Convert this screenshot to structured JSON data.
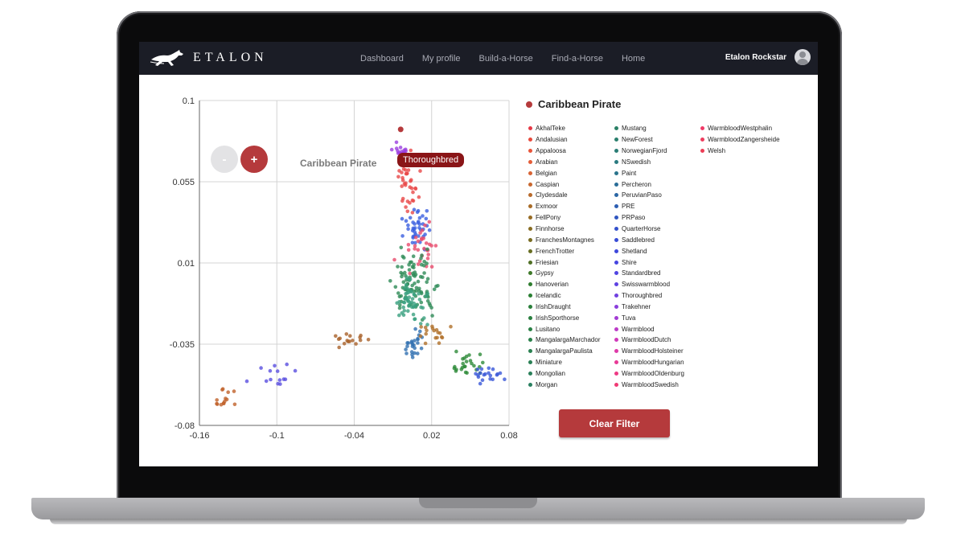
{
  "app": {
    "name": "ETALON"
  },
  "nav": {
    "links": [
      "Dashboard",
      "My profile",
      "Build-a-Horse",
      "Find-a-Horse",
      "Home"
    ],
    "user": "Etalon Rockstar"
  },
  "controls": {
    "zoom_out": "-",
    "zoom_in": "+",
    "clear_filter": "Clear Filter"
  },
  "selected": {
    "name": "Caribbean Pirate",
    "tooltip": "Thoroughbred",
    "color": "#b53a3c"
  },
  "chart_data": {
    "type": "scatter",
    "xlim": [
      -0.16,
      0.08
    ],
    "ylim": [
      -0.08,
      0.1
    ],
    "x_ticks": [
      "-0.16",
      "-0.1",
      "-0.04",
      "0.02",
      "0.08"
    ],
    "y_ticks": [
      "0.1",
      "0.055",
      "0.01",
      "-0.035",
      "-0.08"
    ],
    "grid": true,
    "highlight": {
      "label": "Caribbean Pirate",
      "breed": "Thoroughbred",
      "x": -0.004,
      "y": 0.084
    },
    "clusters": [
      {
        "breed_group": "Thoroughbred",
        "color": "#9b3fe0",
        "center": [
          -0.003,
          0.07
        ],
        "spread": [
          0.003,
          0.003
        ],
        "n": 26
      },
      {
        "breed_group": "Arabian",
        "color": "#e84848",
        "center": [
          0.002,
          0.055
        ],
        "spread": [
          0.004,
          0.008
        ],
        "n": 40
      },
      {
        "breed_group": "Saddlebred",
        "color": "#3b5fe0",
        "center": [
          0.008,
          0.03
        ],
        "spread": [
          0.005,
          0.005
        ],
        "n": 40
      },
      {
        "breed_group": "Warmblood",
        "color": "#e84a6b",
        "center": [
          0.012,
          0.018
        ],
        "spread": [
          0.008,
          0.006
        ],
        "n": 30
      },
      {
        "breed_group": "Hanoverian",
        "color": "#2e8b57",
        "center": [
          0.008,
          -0.002
        ],
        "spread": [
          0.008,
          0.008
        ],
        "n": 90
      },
      {
        "breed_group": "Morgan",
        "color": "#3aa080",
        "center": [
          0.004,
          -0.012
        ],
        "spread": [
          0.006,
          0.006
        ],
        "n": 50
      },
      {
        "breed_group": "Paint",
        "color": "#2f6fb0",
        "center": [
          0.005,
          -0.035
        ],
        "spread": [
          0.004,
          0.004
        ],
        "n": 25
      },
      {
        "breed_group": "FellPony",
        "color": "#b0702a",
        "center": [
          0.02,
          -0.03
        ],
        "spread": [
          0.006,
          0.003
        ],
        "n": 18
      },
      {
        "breed_group": "Icelandic",
        "color": "#2e8b3a",
        "center": [
          0.045,
          -0.047
        ],
        "spread": [
          0.008,
          0.004
        ],
        "n": 25
      },
      {
        "breed_group": "Shetland",
        "color": "#3a58d8",
        "center": [
          0.064,
          -0.053
        ],
        "spread": [
          0.005,
          0.003
        ],
        "n": 20
      },
      {
        "breed_group": "Exmoor",
        "color": "#a9622a",
        "center": [
          -0.042,
          -0.033
        ],
        "spread": [
          0.008,
          0.002
        ],
        "n": 16
      },
      {
        "breed_group": "Shire",
        "color": "#5a4fe0",
        "center": [
          -0.1,
          -0.052
        ],
        "spread": [
          0.01,
          0.003
        ],
        "n": 14
      },
      {
        "breed_group": "Caspian",
        "color": "#c0622a",
        "center": [
          -0.142,
          -0.064
        ],
        "spread": [
          0.006,
          0.003
        ],
        "n": 14
      }
    ]
  },
  "legend": {
    "columns": [
      [
        {
          "label": "AkhalTeke",
          "color": "#e63946"
        },
        {
          "label": "Andalusian",
          "color": "#e84a3c"
        },
        {
          "label": "Appaloosa",
          "color": "#e8553a"
        },
        {
          "label": "Arabian",
          "color": "#e45d38"
        },
        {
          "label": "Belgian",
          "color": "#d86435"
        },
        {
          "label": "Caspian",
          "color": "#c8672f"
        },
        {
          "label": "Clydesdale",
          "color": "#b86a2b"
        },
        {
          "label": "Exmoor",
          "color": "#a86b27"
        },
        {
          "label": "FellPony",
          "color": "#986c24"
        },
        {
          "label": "Finnhorse",
          "color": "#886c22"
        },
        {
          "label": "FranchesMontagnes",
          "color": "#786c21"
        },
        {
          "label": "FrenchTrotter",
          "color": "#686e22"
        },
        {
          "label": "Friesian",
          "color": "#507025"
        },
        {
          "label": "Gypsy",
          "color": "#3f7a2a"
        },
        {
          "label": "Hanoverian",
          "color": "#2f7d2f"
        },
        {
          "label": "Icelandic",
          "color": "#2a7f33"
        },
        {
          "label": "IrishDraught",
          "color": "#2a7f3a"
        },
        {
          "label": "IrishSporthorse",
          "color": "#2a7f40"
        },
        {
          "label": "Lusitano",
          "color": "#2a8045"
        },
        {
          "label": "MangalargaMarchador",
          "color": "#2a804a"
        },
        {
          "label": "MangalargaPaulista",
          "color": "#2a8050"
        },
        {
          "label": "Miniature",
          "color": "#2a8055"
        },
        {
          "label": "Mongolian",
          "color": "#2a805a"
        },
        {
          "label": "Morgan",
          "color": "#2a8060"
        }
      ],
      [
        {
          "label": "Mustang",
          "color": "#2a8066"
        },
        {
          "label": "NewForest",
          "color": "#2a7f6d"
        },
        {
          "label": "NorwegianFjord",
          "color": "#2a7d75"
        },
        {
          "label": "NSwedish",
          "color": "#2a7a80"
        },
        {
          "label": "Paint",
          "color": "#2a748c"
        },
        {
          "label": "Percheron",
          "color": "#2a6d98"
        },
        {
          "label": "PeruvianPaso",
          "color": "#2a66a4"
        },
        {
          "label": "PRE",
          "color": "#2c5eb2"
        },
        {
          "label": "PRPaso",
          "color": "#2f56c0"
        },
        {
          "label": "QuarterHorse",
          "color": "#3350cc"
        },
        {
          "label": "Saddlebred",
          "color": "#384cd6"
        },
        {
          "label": "Shetland",
          "color": "#3e48dc"
        },
        {
          "label": "Shire",
          "color": "#4645e0"
        },
        {
          "label": "Standardbred",
          "color": "#5044e2"
        },
        {
          "label": "Swisswarmblood",
          "color": "#5e42e2"
        },
        {
          "label": "Thoroughbred",
          "color": "#7040e0"
        },
        {
          "label": "Trakehner",
          "color": "#8a3edc"
        },
        {
          "label": "Tuva",
          "color": "#a33cd4"
        },
        {
          "label": "Warmblood",
          "color": "#bc3bc8"
        },
        {
          "label": "WarmbloodDutch",
          "color": "#d03aba"
        },
        {
          "label": "WarmbloodHolsteiner",
          "color": "#de3aa8"
        },
        {
          "label": "WarmbloodHungarian",
          "color": "#e83a96"
        },
        {
          "label": "WarmbloodOldenburg",
          "color": "#ee3a84"
        },
        {
          "label": "WarmbloodSwedish",
          "color": "#f03a74"
        }
      ],
      [
        {
          "label": "WarmbloodWestphalin",
          "color": "#f03b68"
        },
        {
          "label": "WarmbloodZangersheide",
          "color": "#ee3c5e"
        },
        {
          "label": "Welsh",
          "color": "#ec3d55"
        }
      ]
    ]
  }
}
